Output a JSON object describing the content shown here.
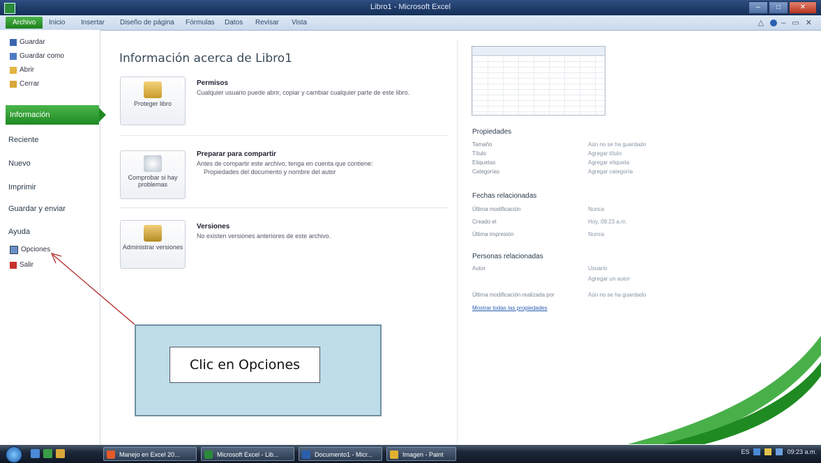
{
  "window": {
    "title": "Libro1 - Microsoft Excel",
    "min": "–",
    "max": "□",
    "close": "✕"
  },
  "tabs": [
    "Archivo",
    "Inicio",
    "Insertar",
    "Diseño de página",
    "Fórmulas",
    "Datos",
    "Revisar",
    "Vista"
  ],
  "nav": {
    "commands": [
      "Guardar",
      "Guardar como",
      "Abrir",
      "Cerrar"
    ],
    "selected": "Información",
    "items": [
      "Reciente",
      "Nuevo",
      "Imprimir",
      "Guardar y enviar",
      "Ayuda"
    ],
    "bottom": [
      "Opciones",
      "Salir"
    ]
  },
  "main": {
    "title": "Información acerca de Libro1",
    "sections": [
      {
        "button": "Proteger libro",
        "title": "Permisos",
        "desc": "Cualquier usuario puede abrir, copiar y cambiar cualquier parte de este libro."
      },
      {
        "button": "Comprobar si hay problemas",
        "title": "Preparar para compartir",
        "desc": "Antes de compartir este archivo, tenga en cuenta que contiene:",
        "bullet": "Propiedades del documento y nombre del autor"
      },
      {
        "button": "Administrar versiones",
        "title": "Versiones",
        "desc": "No existen versiones anteriores de este archivo."
      }
    ]
  },
  "properties": {
    "header": "Propiedades",
    "rows": [
      {
        "k": "Tamaño",
        "v": "Aún no se ha guardado"
      },
      {
        "k": "Título",
        "v": "Agregar título"
      },
      {
        "k": "Etiquetas",
        "v": "Agregar etiqueta"
      },
      {
        "k": "Categorías",
        "v": "Agregar categoría"
      }
    ],
    "dates_header": "Fechas relacionadas",
    "dates": [
      {
        "k": "Última modificación",
        "v": "Nunca"
      },
      {
        "k": "Creado el",
        "v": "Hoy, 09:23 a.m."
      },
      {
        "k": "Última impresión",
        "v": "Nunca"
      }
    ],
    "people_header": "Personas relacionadas",
    "people": [
      {
        "k": "Autor",
        "v": "Usuario"
      },
      {
        "k": "",
        "v": "Agregar un autor"
      },
      {
        "k": "Última modificación realizada por",
        "v": "Aún no se ha guardado"
      }
    ],
    "link": "Mostrar todas las propiedades"
  },
  "callout": {
    "text": "Clic en Opciones"
  },
  "taskbar": {
    "items": [
      "Manejo en Excel 20...",
      "Microsoft Excel - Lib...",
      "Documento1 - Micr...",
      "Imagen - Paint"
    ],
    "clock": "09:23 a.m."
  }
}
